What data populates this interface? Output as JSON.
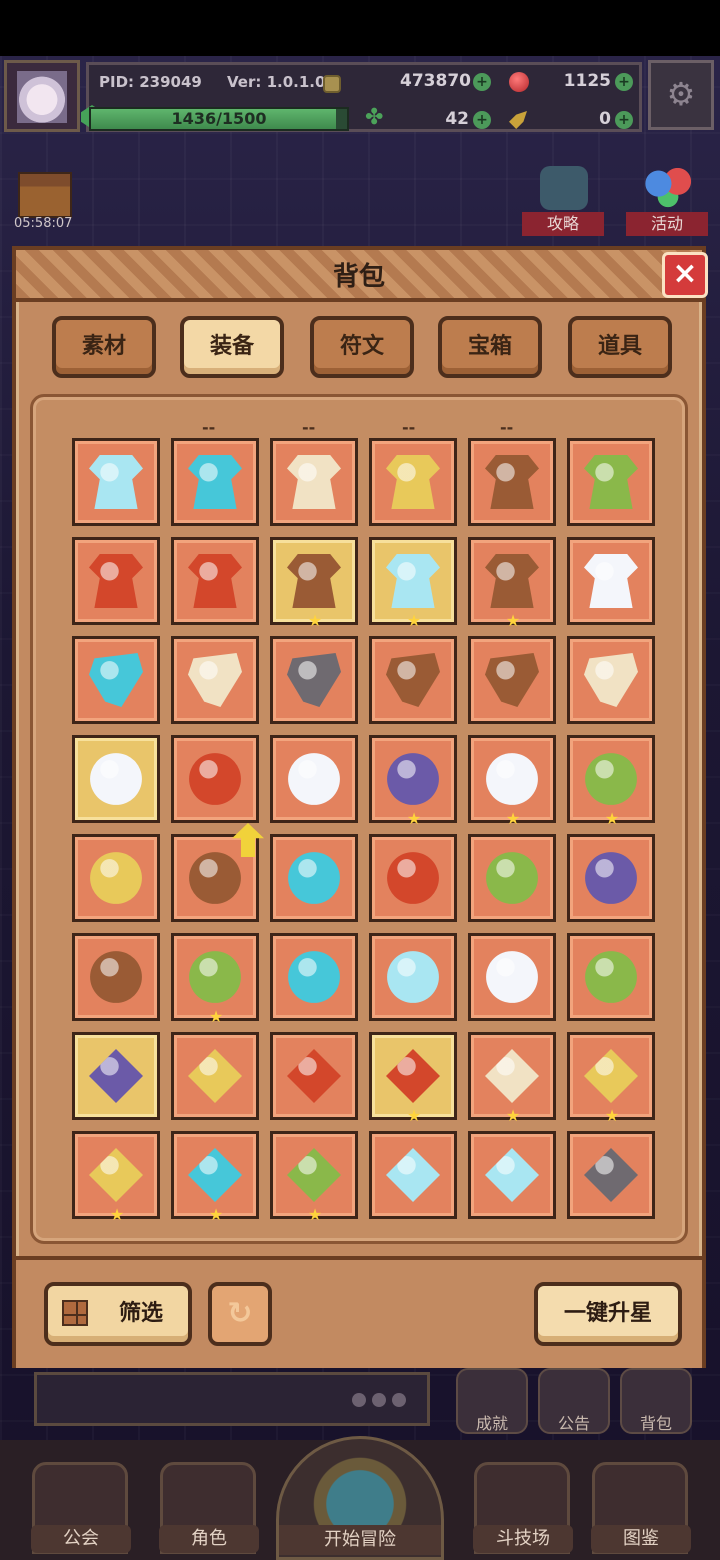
{
  "hud": {
    "pid": "PID: 239049",
    "version": "Ver: 1.0.1.0",
    "gold": "473870",
    "red_gems": "1125",
    "xp": "1436/1500",
    "xp_progress": 0.957,
    "clover_count": "42",
    "key_count": "0"
  },
  "timer": "05:58:07",
  "side_buttons": {
    "guide": "攻略",
    "event": "活动"
  },
  "panel": {
    "title": "背包",
    "close": "×"
  },
  "tabs": [
    {
      "label": "素材",
      "active": false
    },
    {
      "label": "装备",
      "active": true
    },
    {
      "label": "符文",
      "active": false
    },
    {
      "label": "宝箱",
      "active": false
    },
    {
      "label": "道具",
      "active": false
    }
  ],
  "column_markers": [
    "--",
    "--",
    "--",
    "--"
  ],
  "item_colors": {
    "icy": "#a9e6f2",
    "gold": "#e8c95a",
    "fire": "#d3472b",
    "stone": "#6f6a70",
    "leather": "#9a5b35",
    "bone": "#f1e2c4",
    "jade": "#8ab84a",
    "violet": "#6b5aa8",
    "cyan": "#46c7d9",
    "white": "#f4f6fb"
  },
  "buttons": {
    "filter": "筛选",
    "refresh_icon": "↻",
    "upstar": "一键升星"
  },
  "under_buttons": [
    "成就",
    "公告",
    "背包"
  ],
  "nav": {
    "guild": "公会",
    "character": "角色",
    "start": "开始冒险",
    "arena": "斗技场",
    "codex": "图鉴"
  }
}
